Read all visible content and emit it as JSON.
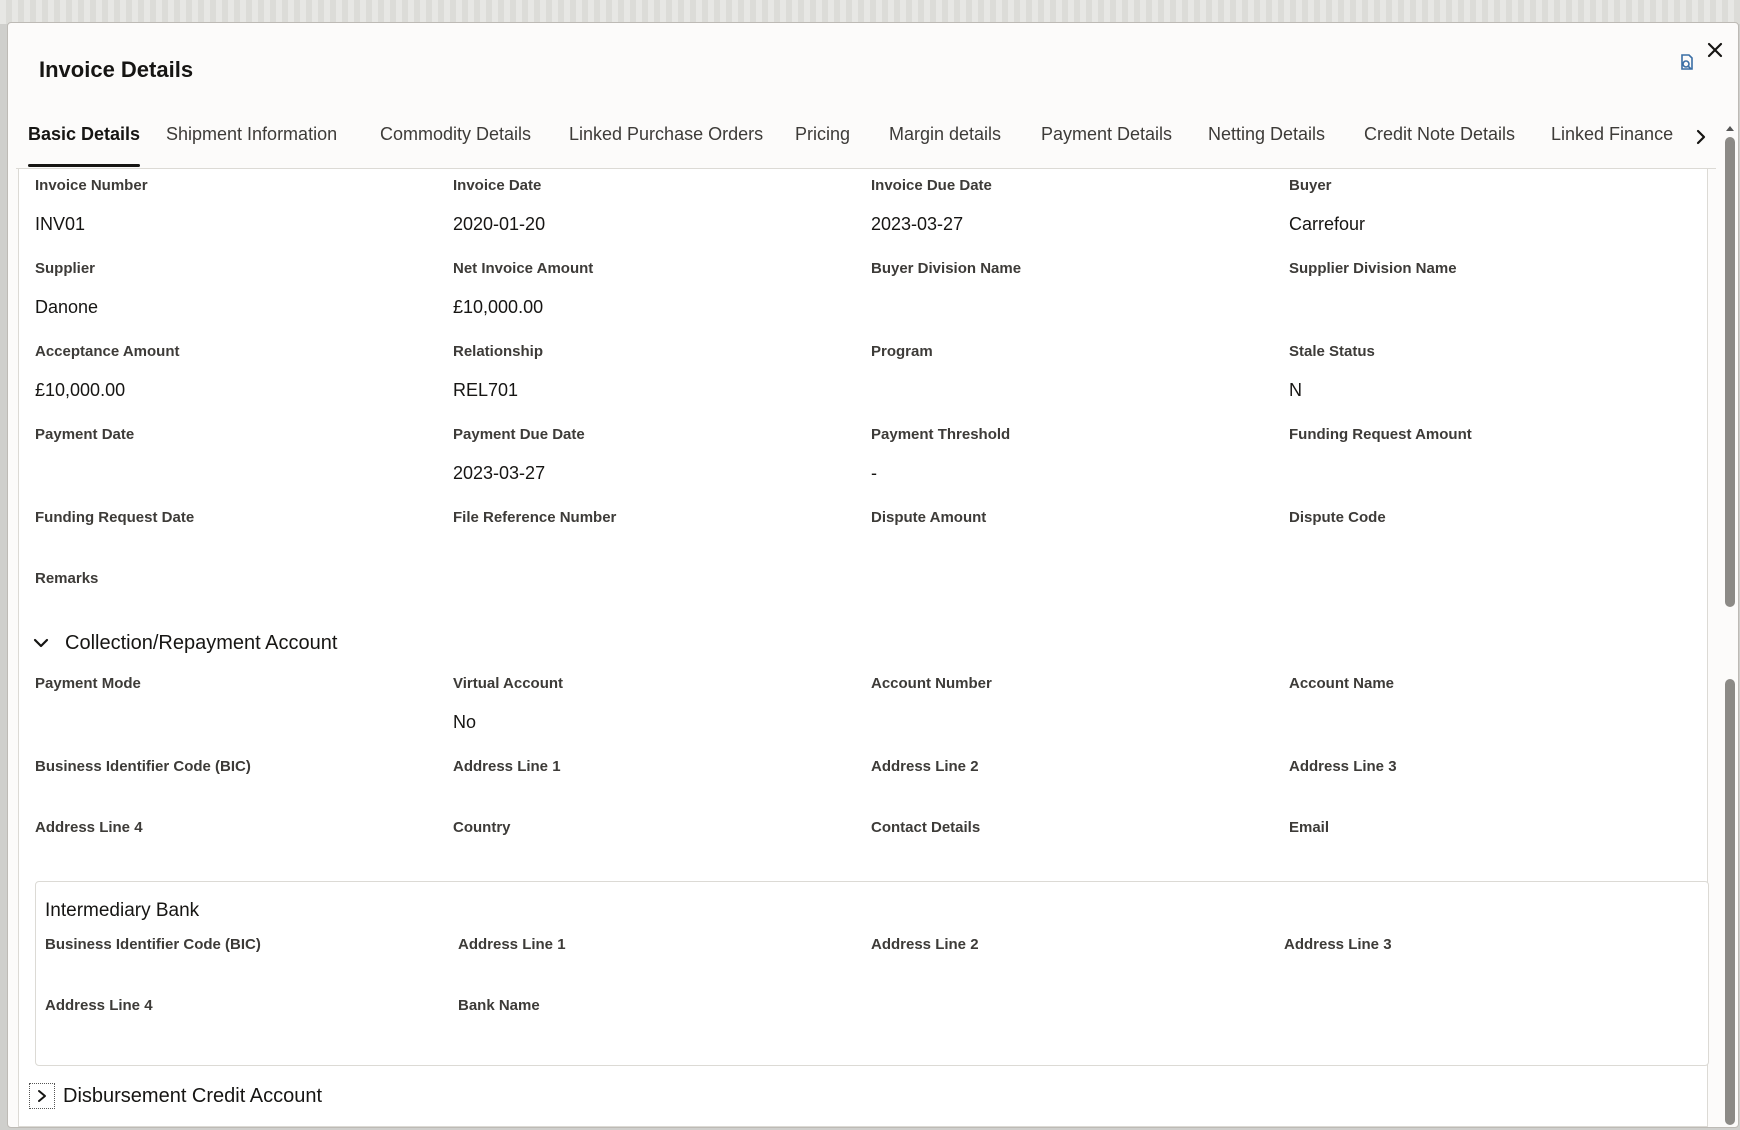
{
  "dialog": {
    "title": "Invoice Details",
    "close_icon": "close-icon",
    "refresh_icon": "refresh-icon"
  },
  "tabs": [
    {
      "label": "Basic Details",
      "active": true
    },
    {
      "label": "Shipment Information",
      "active": false
    },
    {
      "label": "Commodity Details",
      "active": false
    },
    {
      "label": "Linked Purchase Orders",
      "active": false
    },
    {
      "label": "Pricing",
      "active": false
    },
    {
      "label": "Margin details",
      "active": false
    },
    {
      "label": "Payment Details",
      "active": false
    },
    {
      "label": "Netting Details",
      "active": false
    },
    {
      "label": "Credit Note Details",
      "active": false
    },
    {
      "label": "Linked Finance",
      "active": false
    }
  ],
  "basic": {
    "invoice_number": {
      "label": "Invoice Number",
      "value": "INV01"
    },
    "invoice_date": {
      "label": "Invoice Date",
      "value": "2020-01-20"
    },
    "invoice_due_date": {
      "label": "Invoice Due Date",
      "value": "2023-03-27"
    },
    "buyer": {
      "label": "Buyer",
      "value": "Carrefour"
    },
    "supplier": {
      "label": "Supplier",
      "value": "Danone"
    },
    "net_invoice_amount": {
      "label": "Net Invoice Amount",
      "value": "£10,000.00"
    },
    "buyer_division_name": {
      "label": "Buyer Division Name",
      "value": ""
    },
    "supplier_division_name": {
      "label": "Supplier Division Name",
      "value": ""
    },
    "acceptance_amount": {
      "label": "Acceptance Amount",
      "value": "£10,000.00"
    },
    "relationship": {
      "label": "Relationship",
      "value": "REL701"
    },
    "program": {
      "label": "Program",
      "value": ""
    },
    "stale_status": {
      "label": "Stale Status",
      "value": "N"
    },
    "payment_date": {
      "label": "Payment Date",
      "value": ""
    },
    "payment_due_date": {
      "label": "Payment Due Date",
      "value": "2023-03-27"
    },
    "payment_threshold": {
      "label": "Payment Threshold",
      "value": "-"
    },
    "funding_request_amount": {
      "label": "Funding Request Amount",
      "value": ""
    },
    "funding_request_date": {
      "label": "Funding Request Date",
      "value": ""
    },
    "file_reference_number": {
      "label": "File Reference Number",
      "value": ""
    },
    "dispute_amount": {
      "label": "Dispute Amount",
      "value": ""
    },
    "dispute_code": {
      "label": "Dispute Code",
      "value": ""
    },
    "remarks": {
      "label": "Remarks",
      "value": ""
    }
  },
  "collection": {
    "title": "Collection/Repayment Account",
    "expanded": true,
    "payment_mode": {
      "label": "Payment Mode",
      "value": ""
    },
    "virtual_account": {
      "label": "Virtual Account",
      "value": "No"
    },
    "account_number": {
      "label": "Account Number",
      "value": ""
    },
    "account_name": {
      "label": "Account Name",
      "value": ""
    },
    "bic": {
      "label": "Business Identifier Code (BIC)",
      "value": ""
    },
    "address_line_1": {
      "label": "Address Line 1",
      "value": ""
    },
    "address_line_2": {
      "label": "Address Line 2",
      "value": ""
    },
    "address_line_3": {
      "label": "Address Line 3",
      "value": ""
    },
    "address_line_4": {
      "label": "Address Line 4",
      "value": ""
    },
    "country": {
      "label": "Country",
      "value": ""
    },
    "contact_details": {
      "label": "Contact Details",
      "value": ""
    },
    "email": {
      "label": "Email",
      "value": ""
    }
  },
  "intermediary": {
    "title": "Intermediary Bank",
    "bic": {
      "label": "Business Identifier Code (BIC)",
      "value": ""
    },
    "address_line_1": {
      "label": "Address Line 1",
      "value": ""
    },
    "address_line_2": {
      "label": "Address Line 2",
      "value": ""
    },
    "address_line_3": {
      "label": "Address Line 3",
      "value": ""
    },
    "address_line_4": {
      "label": "Address Line 4",
      "value": ""
    },
    "bank_name": {
      "label": "Bank Name",
      "value": ""
    }
  },
  "disbursement": {
    "title": "Disbursement Credit Account",
    "expanded": false
  },
  "colors": {
    "text_primary": "#161513",
    "text_label": "#3d3b38",
    "border": "#dcdad5",
    "dialog_bg": "#fcfbfa"
  }
}
